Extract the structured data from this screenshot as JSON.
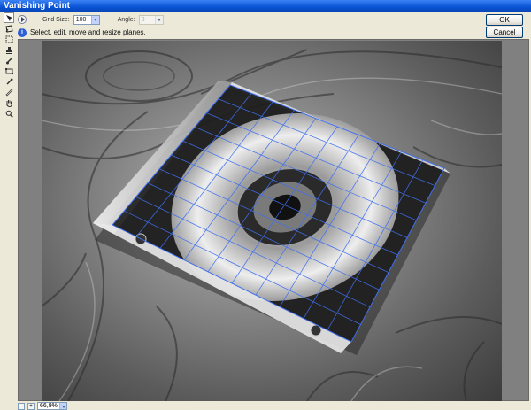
{
  "window": {
    "title": "Vanishing Point"
  },
  "toolbar": {
    "grid_size_label": "Grid Size:",
    "grid_size_value": "100",
    "angle_label": "Angle:",
    "angle_value": "0"
  },
  "hint": {
    "text": "Select, edit, move and resize planes."
  },
  "buttons": {
    "ok": "OK",
    "cancel": "Cancel"
  },
  "tools": [
    {
      "name": "edit-plane-tool-icon"
    },
    {
      "name": "create-plane-tool-icon"
    },
    {
      "name": "marquee-tool-icon"
    },
    {
      "name": "stamp-tool-icon"
    },
    {
      "name": "brush-tool-icon"
    },
    {
      "name": "transform-tool-icon"
    },
    {
      "name": "eyedropper-tool-icon"
    },
    {
      "name": "measure-tool-icon"
    },
    {
      "name": "hand-tool-icon"
    },
    {
      "name": "zoom-tool-icon"
    }
  ],
  "status": {
    "zoom_value": "66,9%",
    "zoom_out_label": "-",
    "zoom_in_label": "+"
  },
  "colors": {
    "grid": "#3f6ff0",
    "titlebar": "#0a53d6",
    "dialog_bg": "#ece9d8"
  }
}
